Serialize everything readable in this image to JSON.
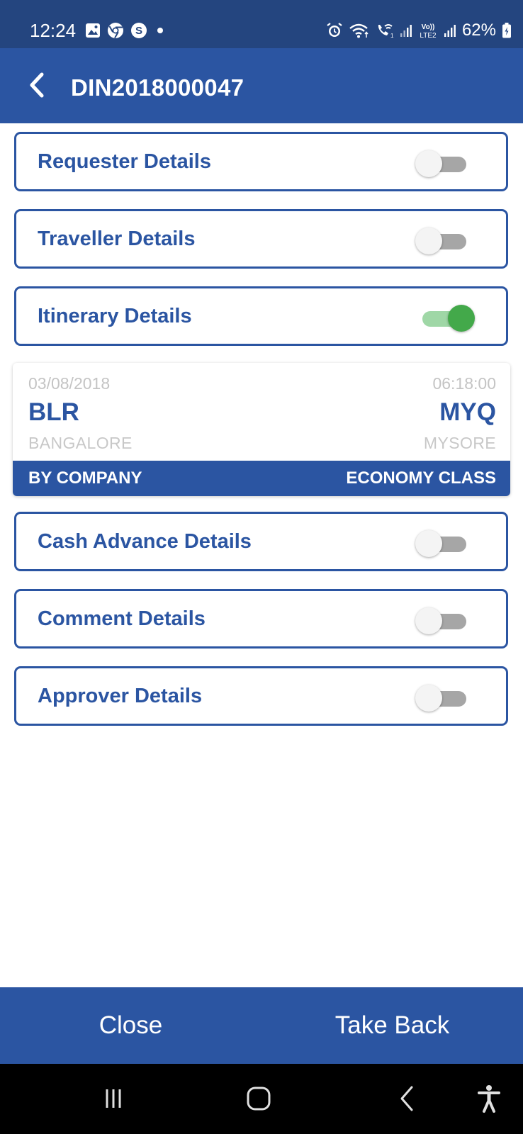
{
  "status_bar": {
    "time": "12:24",
    "battery_percent": "62%",
    "left_icons": [
      "gallery-icon",
      "chrome-icon",
      "s-app-icon",
      "dot-icon"
    ],
    "right_icons": [
      "alarm-icon",
      "wifi-icon",
      "wifi-call-icon",
      "signal-icon",
      "volte-lte2-icon",
      "signal-icon",
      "battery-icon"
    ]
  },
  "app_bar": {
    "title": "DIN2018000047",
    "back_icon": "chevron-left-icon"
  },
  "sections": [
    {
      "label": "Requester Details",
      "expanded": false
    },
    {
      "label": "Traveller Details",
      "expanded": false
    },
    {
      "label": "Itinerary Details",
      "expanded": true
    },
    {
      "label": "Cash Advance Details",
      "expanded": false
    },
    {
      "label": "Comment Details",
      "expanded": false
    },
    {
      "label": "Approver Details",
      "expanded": false
    }
  ],
  "itinerary": {
    "date": "03/08/2018",
    "time": "06:18:00",
    "from_code": "BLR",
    "to_code": "MYQ",
    "from_city": "BANGALORE",
    "to_city": "MYSORE",
    "payment": "BY COMPANY",
    "travel_class": "ECONOMY CLASS"
  },
  "actions": {
    "close_label": "Close",
    "take_back_label": "Take Back"
  },
  "nav_bar": {
    "icons": [
      "recent-apps-icon",
      "home-icon",
      "back-icon",
      "accessibility-icon"
    ]
  },
  "colors": {
    "primary": "#2b55a2",
    "status_bar": "#24457f",
    "toggle_on": "#43a94a",
    "toggle_off": "#a6a6a6",
    "muted_text": "#c4c4c4"
  }
}
